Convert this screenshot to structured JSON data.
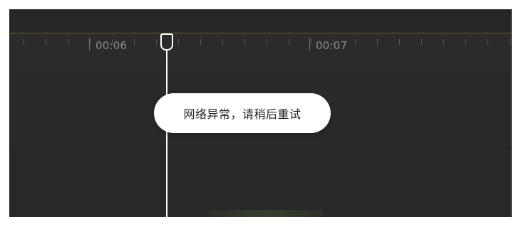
{
  "timeline": {
    "labels": [
      "00:06",
      "00:07"
    ]
  },
  "toast": {
    "message": "网络异常，请稍后重试"
  },
  "colors": {
    "background": "#2a2a2a",
    "accent_line": "#6b5f2a",
    "playhead": "#ffffff",
    "toast_bg": "#ffffff"
  }
}
